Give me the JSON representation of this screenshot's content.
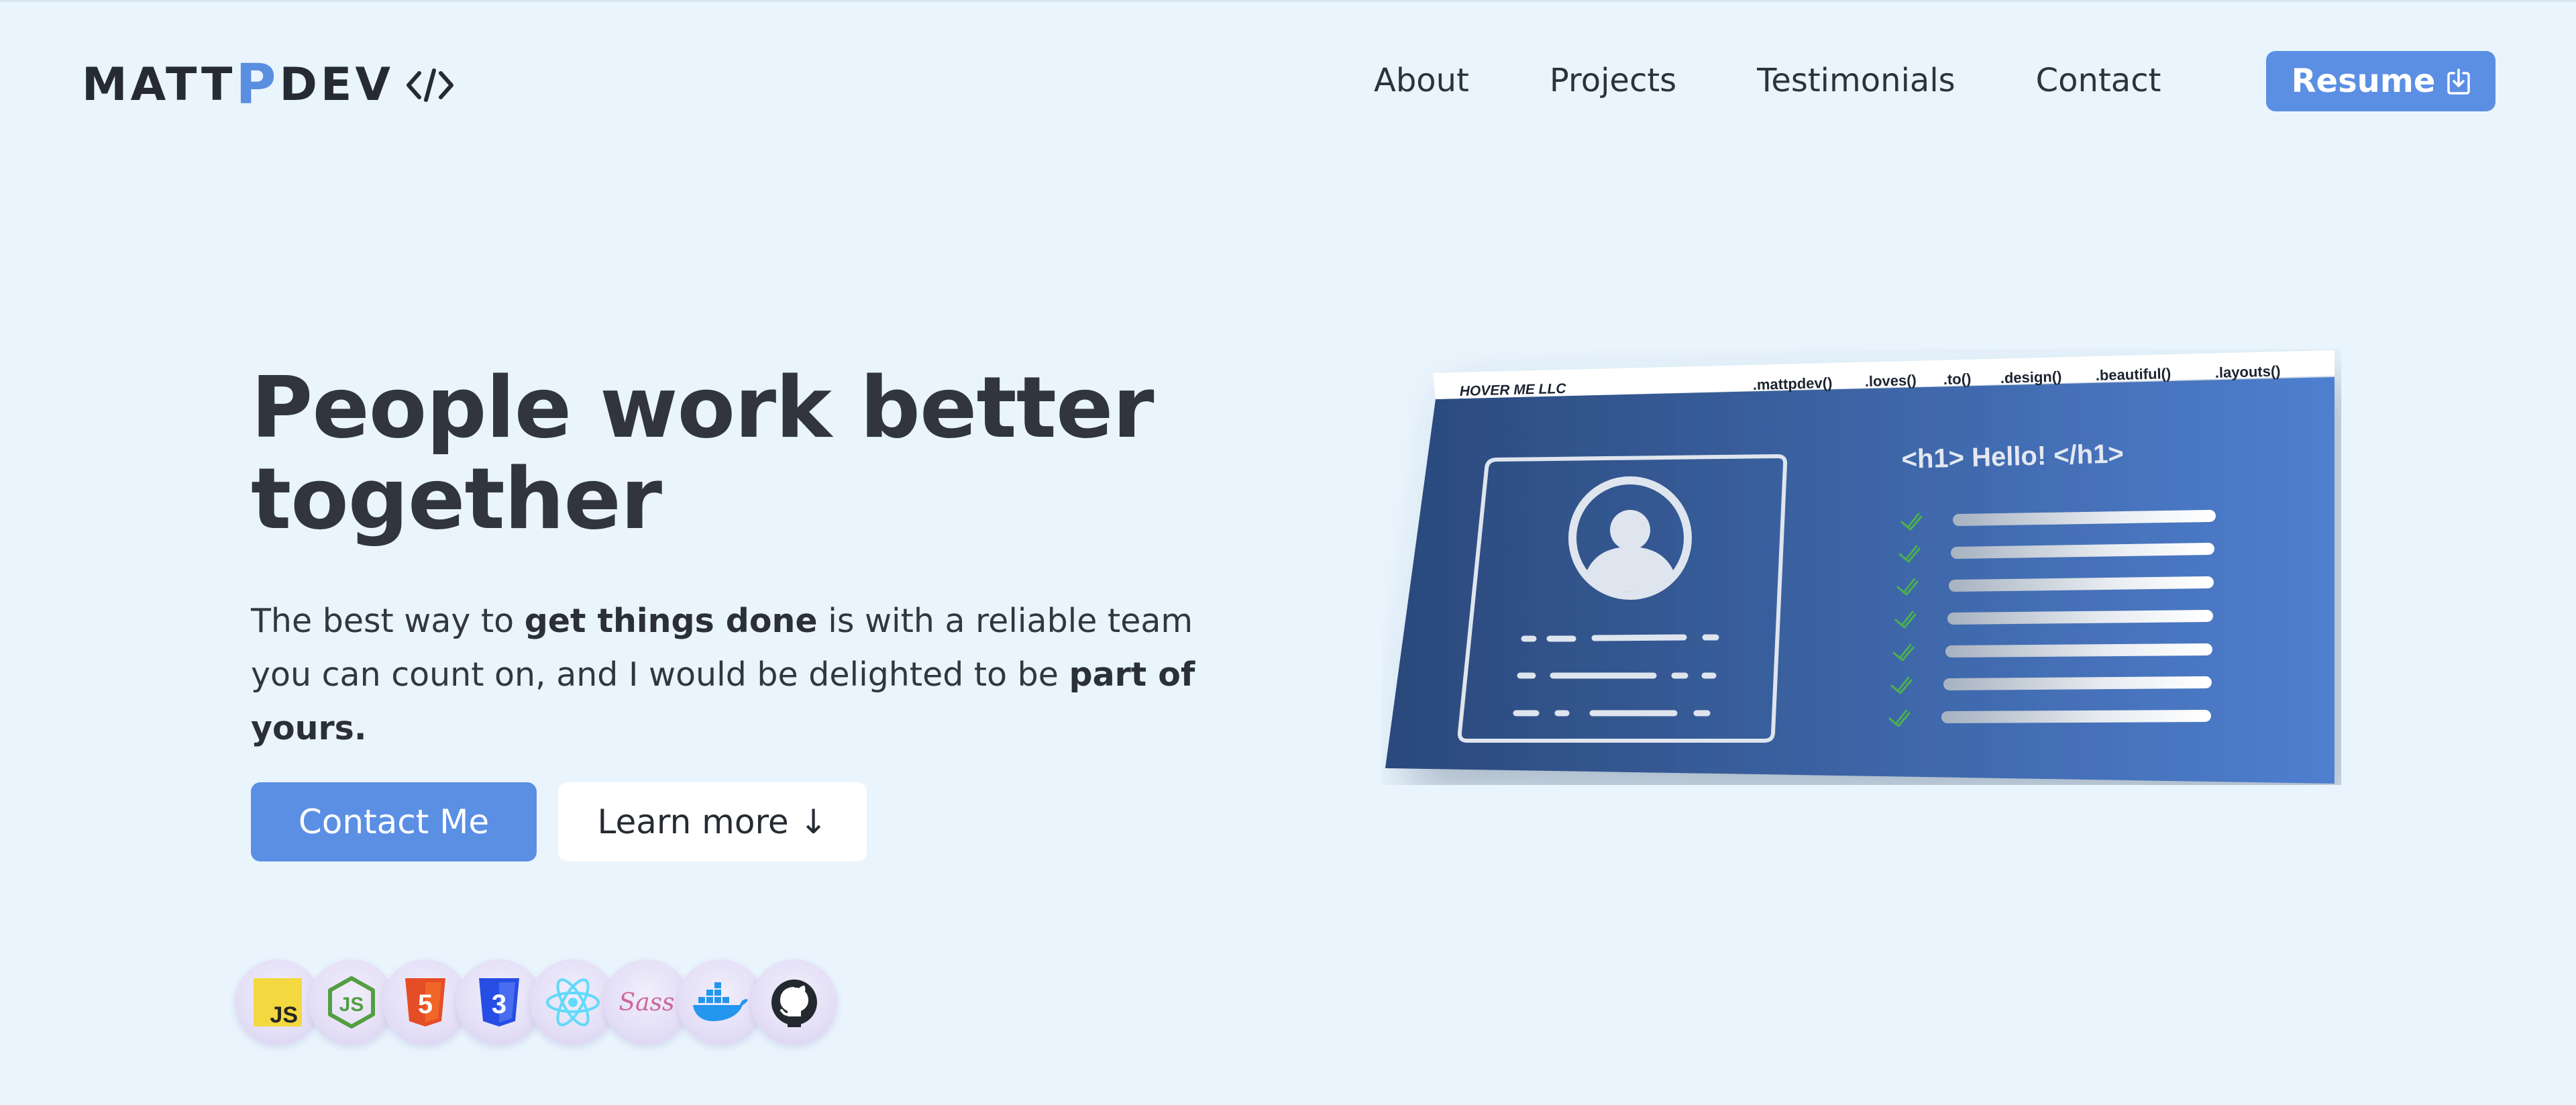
{
  "header": {
    "logo": {
      "prefix": "MATT",
      "accent": "P",
      "suffix": "DEV",
      "icon": "code-brackets-icon"
    },
    "nav": [
      {
        "label": "About"
      },
      {
        "label": "Projects"
      },
      {
        "label": "Testimonials"
      },
      {
        "label": "Contact"
      }
    ],
    "resume": {
      "label": "Resume",
      "icon": "download-icon"
    }
  },
  "hero": {
    "title": "People work better together",
    "description": {
      "part1": "The best way to ",
      "bold1": "get things done",
      "part2": " is with a reliable team you can count on, and I would be delighted to be ",
      "bold2": "part of yours."
    },
    "contact_button": "Contact Me",
    "learn_button": "Learn more ↓",
    "tech_icons": [
      {
        "name": "javascript-icon",
        "text": "JS"
      },
      {
        "name": "nodejs-icon",
        "text": "JS"
      },
      {
        "name": "html5-icon",
        "text": "5"
      },
      {
        "name": "css3-icon",
        "text": "3"
      },
      {
        "name": "react-icon"
      },
      {
        "name": "sass-icon",
        "text": "Sass"
      },
      {
        "name": "docker-icon"
      },
      {
        "name": "github-icon"
      }
    ]
  },
  "illustration": {
    "browser_title": "HOVER ME LLC",
    "tabs": [
      ".mattpdev()",
      ".loves()",
      ".to()",
      ".design()",
      ".beautiful()",
      ".layouts()"
    ],
    "heading": "<h1> Hello! </h1>",
    "checklist_count": 7
  },
  "colors": {
    "background": "#e9f4fd",
    "accent": "#5b8fe3",
    "text": "#30353e",
    "card_dark": "#2b4a7e",
    "card_light": "#4f80cf",
    "check": "#4caf50"
  }
}
